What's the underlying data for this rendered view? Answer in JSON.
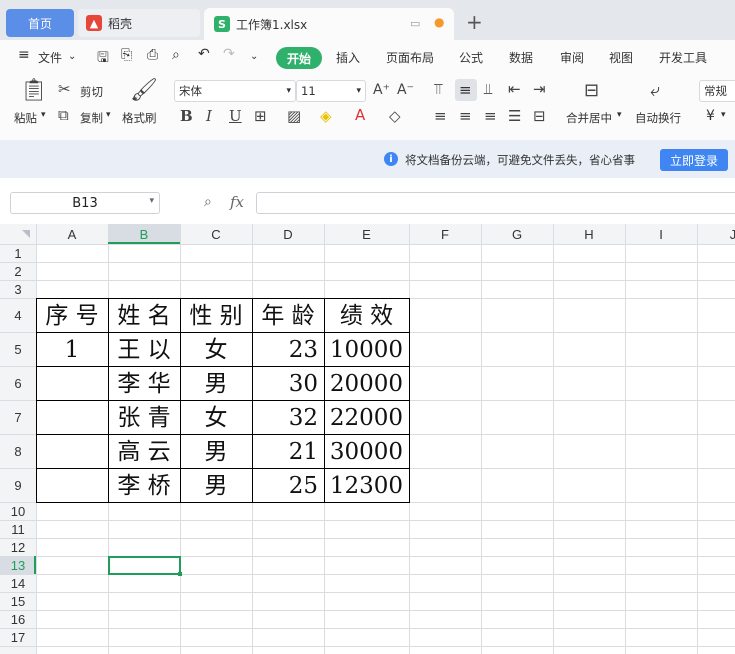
{
  "tabs": {
    "home": "首页",
    "daoke": "稻壳",
    "workbook": "工作簿1.xlsx",
    "add": "+"
  },
  "menu": {
    "file": "文件",
    "start": "开始",
    "insert": "插入",
    "page_layout": "页面布局",
    "formula": "公式",
    "data": "数据",
    "review": "审阅",
    "view": "视图",
    "developer": "开发工具"
  },
  "ribbon": {
    "paste": "粘贴",
    "cut": "剪切",
    "copy": "复制",
    "format_painter": "格式刷",
    "font_name": "宋体",
    "font_size": "11",
    "merge_center": "合并居中",
    "wrap_text": "自动换行",
    "number_format": "常规",
    "currency_symbol": "¥"
  },
  "notice": {
    "message": "将文档备份云端，可避免文件丢失，省心省事",
    "login": "立即登录"
  },
  "formula_bar": {
    "cell_ref": "B13",
    "fx": "fx",
    "content": ""
  },
  "sheet": {
    "columns": [
      "A",
      "B",
      "C",
      "D",
      "E",
      "F",
      "G",
      "H",
      "I",
      "J"
    ],
    "rows": [
      "1",
      "2",
      "3",
      "4",
      "5",
      "6",
      "7",
      "8",
      "9",
      "10",
      "11",
      "12",
      "13",
      "14",
      "15",
      "16",
      "17"
    ],
    "selected_cell": "B13",
    "table": {
      "header": [
        "序 号",
        "姓 名",
        "性 别",
        "年 龄",
        "绩   效"
      ],
      "records": [
        [
          "1",
          "王 以",
          "女",
          "23",
          "10000"
        ],
        [
          "",
          "李 华",
          "男",
          "30",
          "20000"
        ],
        [
          "",
          "张 青",
          "女",
          "32",
          "22000"
        ],
        [
          "",
          "高 云",
          "男",
          "21",
          "30000"
        ],
        [
          "",
          "李 桥",
          "男",
          "25",
          "12300"
        ]
      ]
    }
  },
  "colors": {
    "accent_green": "#2fb16b",
    "selection_green": "#1e9e5a",
    "home_tab_blue": "#5b8ee6",
    "login_blue": "#3f86f2"
  }
}
